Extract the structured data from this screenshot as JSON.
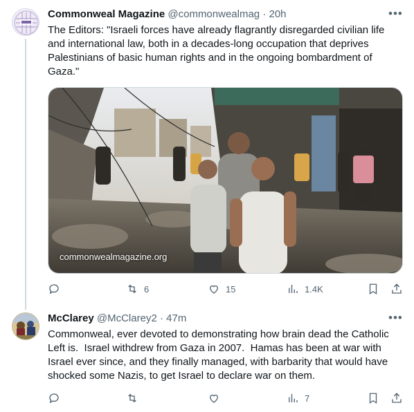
{
  "tweets": [
    {
      "author_name": "Commonweal Magazine",
      "handle": "@commonwealmag",
      "separator": "·",
      "time": "20h",
      "text": "The Editors: \"Israeli forces have already flagrantly disregarded civilian life and international law, both in a decades-long occupation that deprives Palestinians of basic human rights and in the ongoing bombardment of Gaza.\"",
      "media_caption": "commonwealmagazine.org",
      "actions": {
        "replies": "",
        "retweets": "6",
        "likes": "15",
        "views": "1.4K"
      }
    },
    {
      "author_name": "McClarey",
      "handle": "@McClarey2",
      "separator": "·",
      "time": "47m",
      "text": "Commonweal, ever devoted to demonstrating how brain dead the Catholic Left is.  Israel withdrew from Gaza in 2007.  Hamas has been at war with Israel ever since, and they finally managed, with barbarity that would have shocked some Nazis, to get Israel to declare war on them.",
      "actions": {
        "replies": "",
        "retweets": "",
        "likes": "",
        "views": "7"
      }
    }
  ],
  "icons": {
    "more": "more-icon",
    "reply": "reply-icon",
    "retweet": "retweet-icon",
    "like": "like-icon",
    "views": "views-icon",
    "bookmark": "bookmark-icon",
    "share": "share-icon"
  },
  "colors": {
    "text": "#0f1419",
    "secondary": "#536471",
    "border": "#cfd9de"
  }
}
